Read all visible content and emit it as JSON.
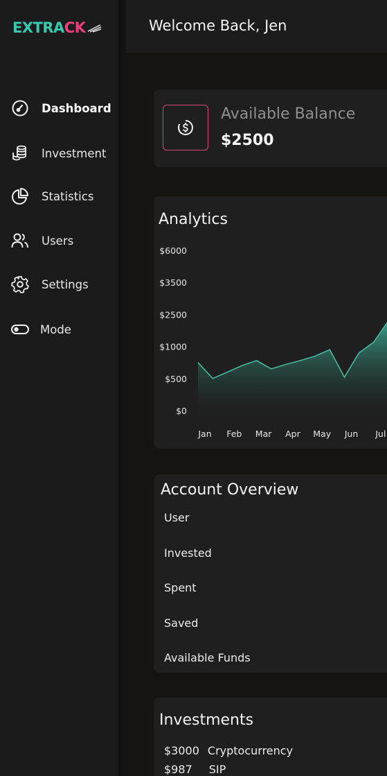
{
  "app": {
    "logo_text_a": "EXTRA",
    "logo_text_b": "CK",
    "colors": {
      "accent_teal": "#37c8b0",
      "accent_pink": "#ec3f7b"
    }
  },
  "header": {
    "welcome": "Welcome Back, Jen"
  },
  "sidebar": {
    "items": [
      {
        "label": "Dashboard",
        "icon": "gauge-icon",
        "active": true
      },
      {
        "label": "Investment",
        "icon": "coins-stack-icon"
      },
      {
        "label": "Statistics",
        "icon": "pie-chart-icon"
      },
      {
        "label": "Users",
        "icon": "users-icon"
      },
      {
        "label": "Settings",
        "icon": "gear-icon"
      },
      {
        "label": "Mode",
        "icon": "toggle-icon"
      }
    ]
  },
  "balance": {
    "label": "Available Balance",
    "value": "$2500",
    "icon": "dollar-coin-icon"
  },
  "analytics": {
    "title": "Analytics"
  },
  "chart_data": {
    "type": "area",
    "title": "Analytics",
    "categories": [
      "Jan",
      "Feb",
      "Mar",
      "Apr",
      "May",
      "Jun",
      "Jul"
    ],
    "y_tick_labels": [
      "$0",
      "$500",
      "$1000",
      "$2500",
      "$3500",
      "$6000"
    ],
    "series": [
      {
        "x": [
          0,
          0.5,
          1,
          1.5,
          2,
          2.5,
          3,
          3.5,
          4,
          4.5,
          5,
          5.5,
          6,
          6.5
        ],
        "values": [
          750,
          500,
          600,
          700,
          780,
          650,
          720,
          780,
          850,
          950,
          520,
          900,
          1200,
          2200
        ]
      }
    ],
    "color": "#3aa58f",
    "grid": false,
    "legend": "none"
  },
  "overview": {
    "title": "Account Overview",
    "rows": [
      "User",
      "Invested",
      "Spent",
      "Saved",
      "Available Funds"
    ]
  },
  "investments": {
    "title": "Investments",
    "rows": [
      {
        "amount": "$3000",
        "name": "Cryptocurrency"
      },
      {
        "amount": "$987",
        "name": "SIP"
      }
    ]
  }
}
